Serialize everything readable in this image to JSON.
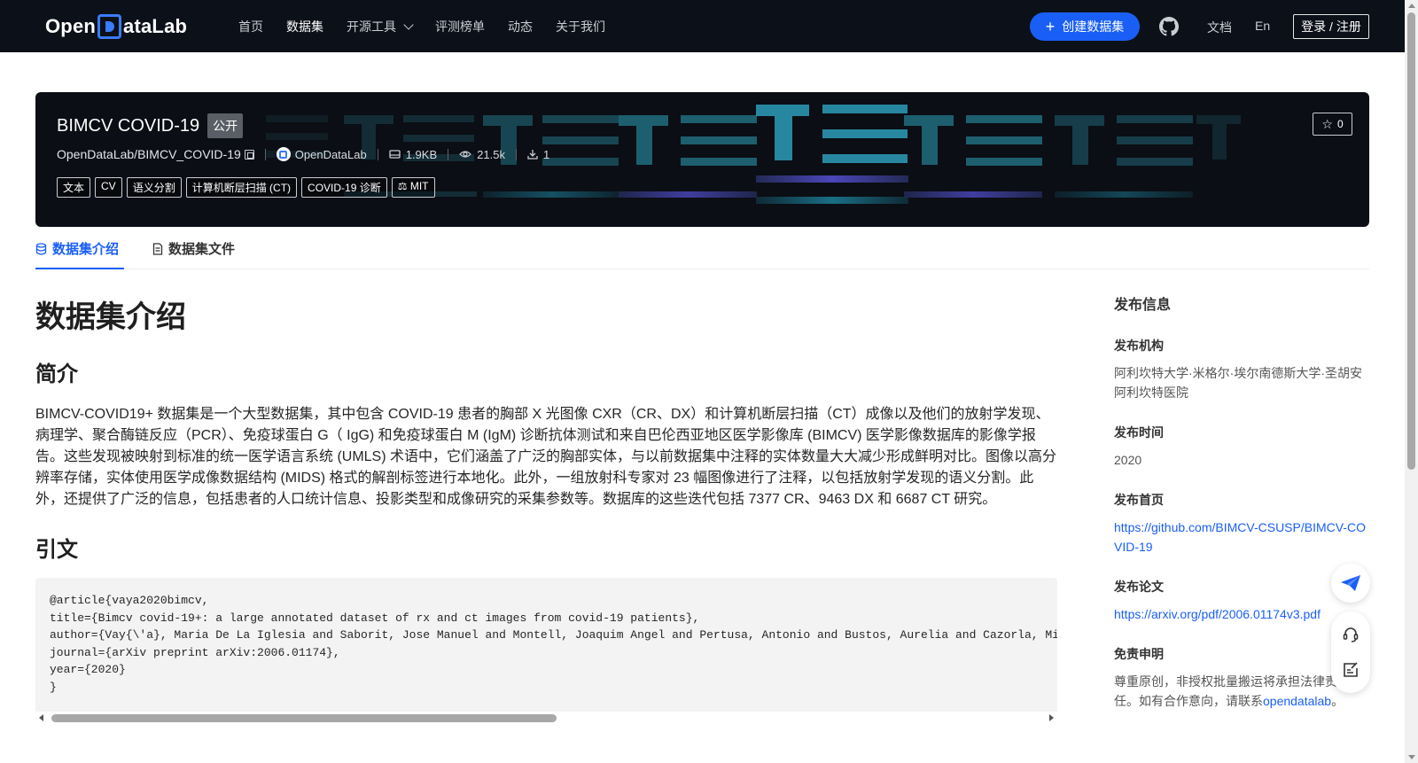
{
  "nav": {
    "logo_text_1": "Open",
    "logo_text_2": "ataLab",
    "items": [
      {
        "label": "首页"
      },
      {
        "label": "数据集"
      },
      {
        "label": "开源工具"
      },
      {
        "label": "评测榜单"
      },
      {
        "label": "动态"
      },
      {
        "label": "关于我们"
      }
    ],
    "create_label": "创建数据集",
    "docs_label": "文档",
    "lang_label": "En",
    "login_label": "登录 / 注册"
  },
  "banner": {
    "title": "BIMCV COVID-19",
    "visibility": "公开",
    "path": "OpenDataLab/BIMCV_COVID-19",
    "org": "OpenDataLab",
    "size": "1.9KB",
    "views": "21.5k",
    "downloads": "1",
    "tags": [
      "文本",
      "CV",
      "语义分割",
      "计算机断层扫描 (CT)",
      "COVID-19 诊断"
    ],
    "license": "MIT",
    "stars": "0"
  },
  "tabs": [
    {
      "label": "数据集介绍"
    },
    {
      "label": "数据集文件"
    }
  ],
  "content": {
    "h1": "数据集介绍",
    "intro_heading": "简介",
    "intro_text": "BIMCV-COVID19+ 数据集是一个大型数据集，其中包含 COVID-19 患者的胸部 X 光图像 CXR（CR、DX）和计算机断层扫描（CT）成像以及他们的放射学发现、病理学、聚合酶链反应（PCR）、免疫球蛋白 G（ IgG) 和免疫球蛋白 M (IgM) 诊断抗体测试和来自巴伦西亚地区医学影像库 (BIMCV) 医学影像数据库的影像学报告。这些发现被映射到标准的统一医学语言系统 (UMLS) 术语中，它们涵盖了广泛的胸部实体，与以前数据集中注释的实体数量大大减少形成鲜明对比。图像以高分辨率存储，实体使用医学成像数据结构 (MIDS) 格式的解剖标签进行本地化。此外，一组放射科专家对 23 幅图像进行了注释，以包括放射学发现的语义分割。此外，还提供了广泛的信息，包括患者的人口统计信息、投影类型和成像研究的采集参数等。数据库的这些迭代包括 7377 CR、9463 DX 和 6687 CT 研究。",
    "citation_heading": "引文",
    "citation_lines": [
      "@article{vaya2020bimcv,",
      "title={Bimcv covid-19+: a large annotated dataset of rx and ct images from covid-19 patients},",
      "author={Vay{\\'a}, Maria De La Iglesia and Saborit, Jose Manuel and Montell, Joaquim Angel and Pertusa, Antonio and Bustos, Aurelia and Cazorla, Miguel and Galant, Joaquin and Barber, Xavier and Orozco-Beltr{\\'a}n, Domingo and Garc{\\'\\i}a-Garc{\\'\\i}a, Francisco and others},",
      "journal={arXiv preprint arXiv:2006.01174},",
      "year={2020}",
      "}"
    ]
  },
  "sidebar": {
    "title": "发布信息",
    "org_label": "发布机构",
    "org_value": "阿利坎特大学·米格尔·埃尔南德斯大学·圣胡安阿利坎特医院",
    "time_label": "发布时间",
    "time_value": "2020",
    "home_label": "发布首页",
    "home_value": "https://github.com/BIMCV-CSUSP/BIMCV-COVID-19",
    "paper_label": "发布论文",
    "paper_value": "https://arxiv.org/pdf/2006.01174v3.pdf",
    "disclaimer_label": "免责申明",
    "disclaimer_text": "尊重原创，非授权批量搬运将承担法律责任。如有合作意向，请联系",
    "disclaimer_link": "opendatalab",
    "disclaimer_end": "。"
  },
  "colors": {
    "accent": "#1a5ff5",
    "nav_bg": "#0c1018",
    "banner_bg": "#0b0e14"
  }
}
